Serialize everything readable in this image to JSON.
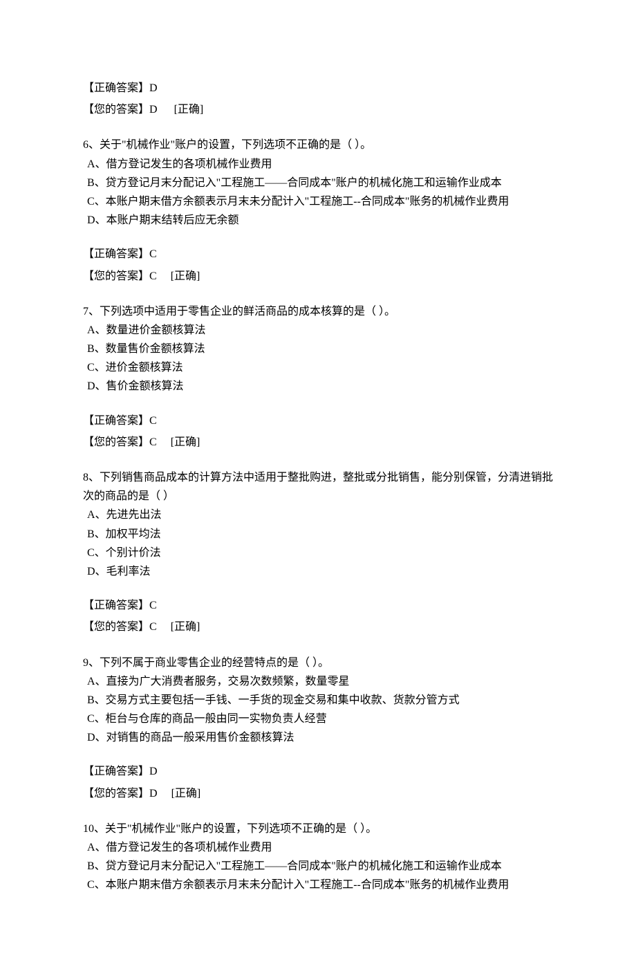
{
  "labels": {
    "correct_prefix": "【正确答案】",
    "your_prefix": "【您的答案】",
    "status_correct": "[正确]"
  },
  "top_answer": {
    "correct": "D",
    "yours": "D"
  },
  "questions": [
    {
      "num": "6",
      "text": "关于\"机械作业\"账户的设置，下列选项不正确的是（ ）。",
      "options": [
        "A、借方登记发生的各项机械作业费用",
        "B、贷方登记月末分配记入\"工程施工——合同成本\"账户的机械化施工和运输作业成本",
        "C、本账户期末借方余额表示月末未分配计入\"工程施工--合同成本\"账务的机械作业费用",
        "D、本账户期末结转后应无余额"
      ],
      "correct": "C",
      "yours": "C"
    },
    {
      "num": "7",
      "text": "下列选项中适用于零售企业的鲜活商品的成本核算的是（ ）。",
      "options": [
        "A、数量进价金额核算法",
        "B、数量售价金额核算法",
        "C、进价金额核算法",
        "D、售价金额核算法"
      ],
      "correct": "C",
      "yours": "C"
    },
    {
      "num": "8",
      "text": "下列销售商品成本的计算方法中适用于整批购进，整批或分批销售，能分别保管，分清进销批次的商品的是（ ）",
      "options": [
        "A、先进先出法",
        "B、加权平均法",
        "C、个别计价法",
        "D、毛利率法"
      ],
      "correct": "C",
      "yours": "C"
    },
    {
      "num": "9",
      "text": "下列不属于商业零售企业的经营特点的是（ ）。",
      "options": [
        "A、直接为广大消费者服务，交易次数频繁，数量零星",
        "B、交易方式主要包括一手钱、一手货的现金交易和集中收款、货款分管方式",
        "C、柜台与仓库的商品一般由同一实物负责人经营",
        "D、对销售的商品一般采用售价金额核算法"
      ],
      "correct": "D",
      "yours": "D"
    },
    {
      "num": "10",
      "text": "关于\"机械作业\"账户的设置，下列选项不正确的是（ ）。",
      "options": [
        "A、借方登记发生的各项机械作业费用",
        "B、贷方登记月末分配记入\"工程施工——合同成本\"账户的机械化施工和运输作业成本",
        "C、本账户期末借方余额表示月末未分配计入\"工程施工--合同成本\"账务的机械作业费用"
      ],
      "correct": null,
      "yours": null
    }
  ]
}
